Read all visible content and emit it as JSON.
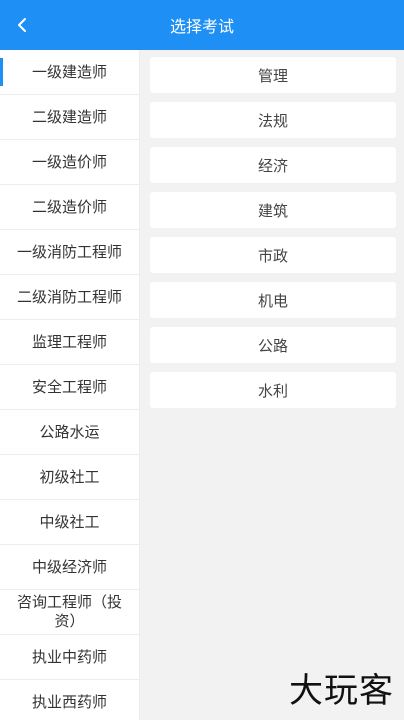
{
  "header": {
    "title": "选择考试"
  },
  "sidebar": {
    "items": [
      {
        "label": "一级建造师"
      },
      {
        "label": "二级建造师"
      },
      {
        "label": "一级造价师"
      },
      {
        "label": "二级造价师"
      },
      {
        "label": "一级消防工程师"
      },
      {
        "label": "二级消防工程师"
      },
      {
        "label": "监理工程师"
      },
      {
        "label": "安全工程师"
      },
      {
        "label": "公路水运"
      },
      {
        "label": "初级社工"
      },
      {
        "label": "中级社工"
      },
      {
        "label": "中级经济师"
      },
      {
        "label": "咨询工程师（投资）"
      },
      {
        "label": "执业中药师"
      },
      {
        "label": "执业西药师"
      }
    ]
  },
  "subjects": [
    {
      "label": "管理"
    },
    {
      "label": "法规"
    },
    {
      "label": "经济"
    },
    {
      "label": "建筑"
    },
    {
      "label": "市政"
    },
    {
      "label": "机电"
    },
    {
      "label": "公路"
    },
    {
      "label": "水利"
    }
  ],
  "watermark": {
    "text": "大玩客"
  },
  "colors": {
    "accent": "#1e90f5"
  }
}
